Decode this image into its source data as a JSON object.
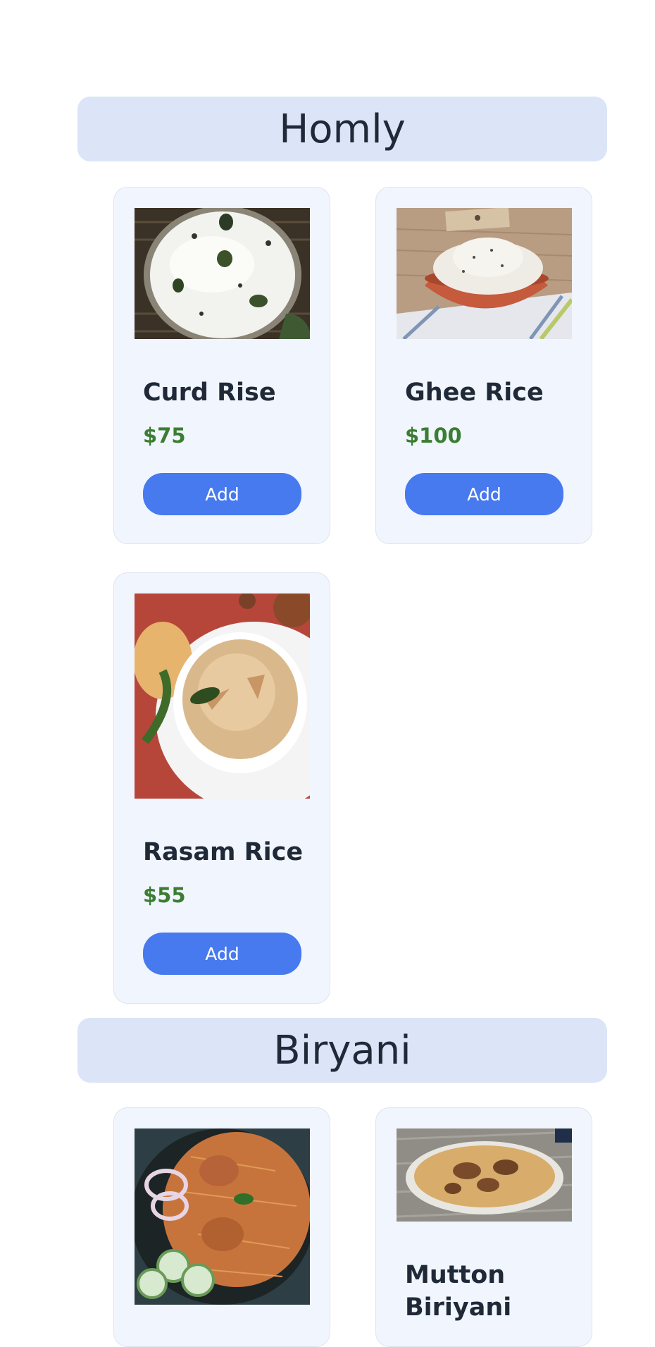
{
  "sections": [
    {
      "title": "Homly",
      "items": [
        {
          "name": "Curd Rise",
          "price": "$75",
          "button": "Add",
          "photo_icon": "curd-rice-photo"
        },
        {
          "name": "Ghee Rice",
          "price": "$100",
          "button": "Add",
          "photo_icon": "ghee-rice-photo"
        },
        {
          "name": "Rasam Rice",
          "price": "$55",
          "button": "Add",
          "photo_icon": "rasam-rice-photo"
        }
      ]
    },
    {
      "title": "Biryani",
      "items": [
        {
          "name": "",
          "photo_icon": "chicken-biryani-photo"
        },
        {
          "name": "Mutton Biriyani",
          "photo_icon": "mutton-biryani-photo"
        }
      ]
    }
  ],
  "colors": {
    "header_bg": "#dbe5f7",
    "card_bg": "#f1f5fd",
    "price": "#3b7d32",
    "button": "#4779ef"
  }
}
